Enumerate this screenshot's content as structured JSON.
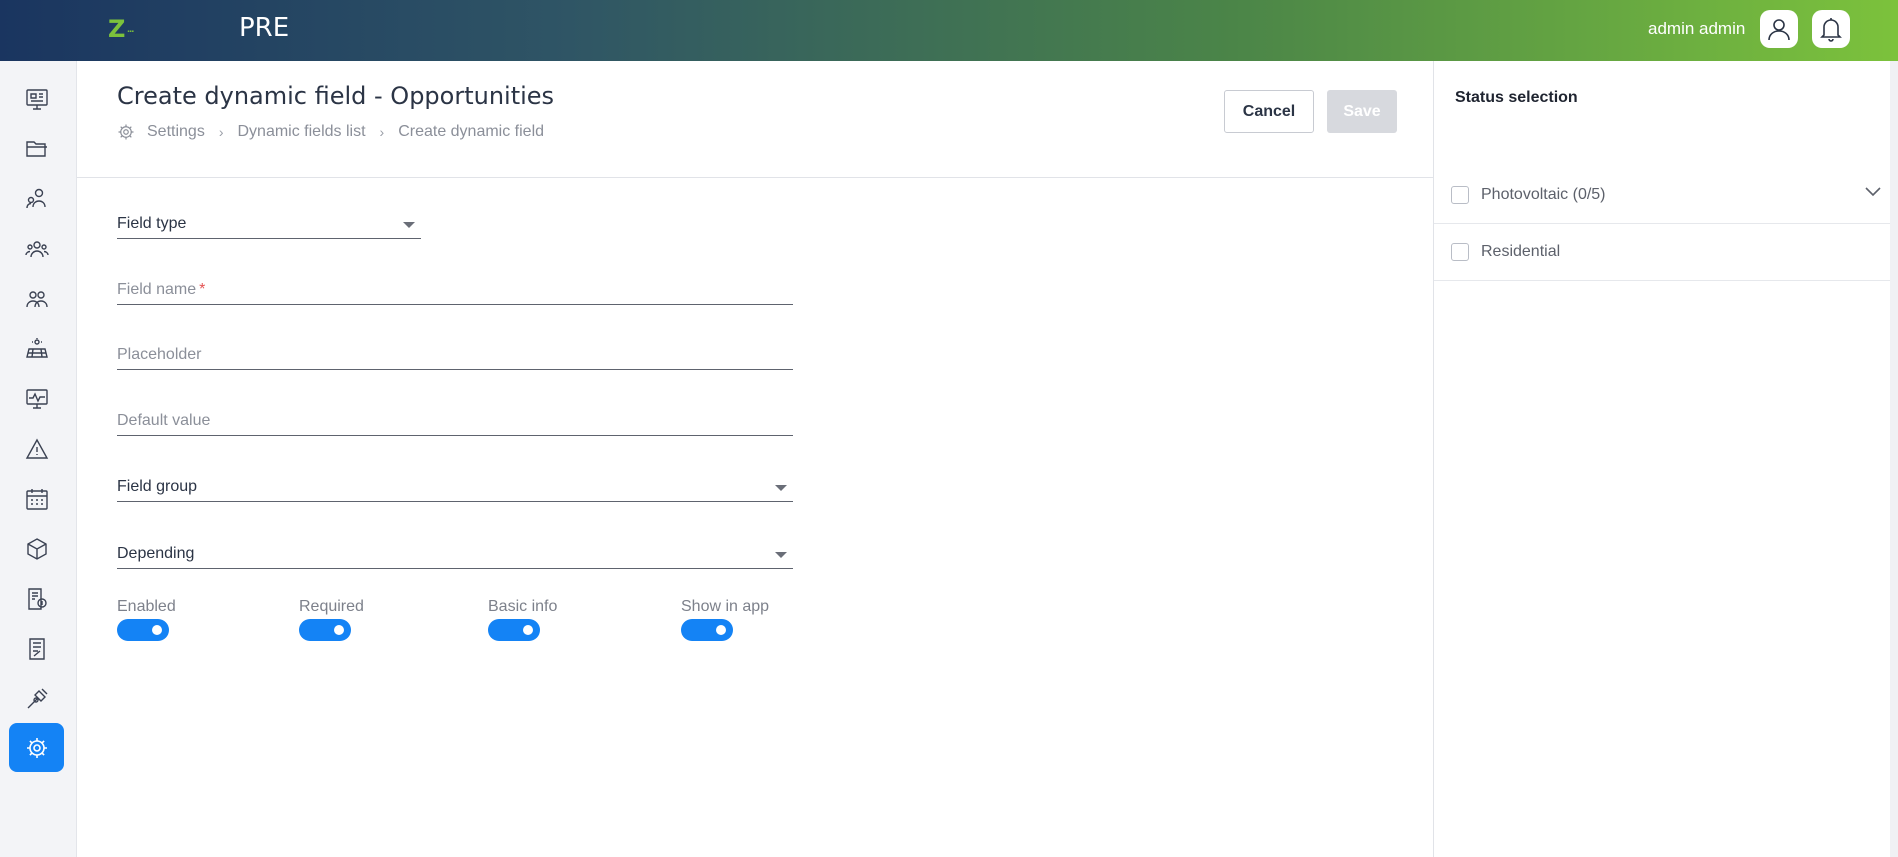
{
  "header": {
    "app_name": "PRE",
    "user_name": "admin admin",
    "icons": [
      "user-icon",
      "bell-icon"
    ],
    "accent_gradient": [
      "#1a3560",
      "#7cc23c"
    ]
  },
  "sidebar": {
    "items": [
      {
        "name": "dashboard-icon"
      },
      {
        "name": "folder-icon"
      },
      {
        "name": "contacts-icon"
      },
      {
        "name": "team-icon"
      },
      {
        "name": "users-icon"
      },
      {
        "name": "solar-panel-icon"
      },
      {
        "name": "monitoring-icon"
      },
      {
        "name": "warning-icon"
      },
      {
        "name": "calendar-icon"
      },
      {
        "name": "box-icon"
      },
      {
        "name": "invoice-icon"
      },
      {
        "name": "document-icon"
      },
      {
        "name": "tools-icon"
      },
      {
        "name": "settings-icon",
        "active": true
      }
    ],
    "active_color": "#1483f5"
  },
  "page": {
    "title": "Create dynamic field - Opportunities",
    "breadcrumb": [
      "Settings",
      "Dynamic fields list",
      "Create dynamic field"
    ],
    "cancel_label": "Cancel",
    "save_label": "Save"
  },
  "form": {
    "field_type_label": "Field type",
    "field_name_label": "Field name",
    "field_name_required_mark": "*",
    "placeholder_label": "Placeholder",
    "default_value_label": "Default value",
    "field_group_label": "Field group",
    "depending_label": "Depending",
    "toggles": [
      {
        "label": "Enabled",
        "on": true
      },
      {
        "label": "Required",
        "on": true
      },
      {
        "label": "Basic info",
        "on": true
      },
      {
        "label": "Show in app",
        "on": true
      }
    ]
  },
  "status_panel": {
    "title": "Status selection",
    "items": [
      {
        "label": "Photovoltaic (0/5)",
        "checked": false,
        "expandable": true
      },
      {
        "label": "Residential",
        "checked": false,
        "expandable": false
      }
    ]
  }
}
